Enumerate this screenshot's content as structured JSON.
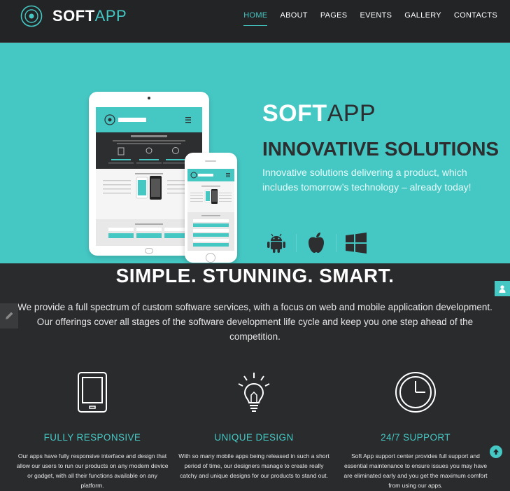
{
  "brand": {
    "bold": "SOFT",
    "light": "APP"
  },
  "nav": {
    "items": [
      {
        "label": "HOME",
        "active": true
      },
      {
        "label": "ABOUT"
      },
      {
        "label": "PAGES"
      },
      {
        "label": "EVENTS"
      },
      {
        "label": "GALLERY"
      },
      {
        "label": "CONTACTS"
      }
    ]
  },
  "hero": {
    "title_bold": "SOFT",
    "title_light": "APP",
    "subtitle": "INNOVATIVE SOLUTIONS",
    "text": "Innovative solutions delivering a product, which includes tomorrow’s technology – already today!",
    "platform_icons": [
      "android-icon",
      "apple-icon",
      "windows-icon"
    ]
  },
  "intro": {
    "title": "SIMPLE. STUNNING. SMART.",
    "text": "We provide a full spectrum of custom software services, with a focus on web and mobile application development. Our offerings cover all stages of the software development life cycle and keep you one step ahead of the competition."
  },
  "features": [
    {
      "icon": "tablet-icon",
      "title": "FULLY RESPONSIVE",
      "text": "Our apps have fully responsive interface and design that allow our users to run our products on any modern device or gadget, with all their functions available on any platform."
    },
    {
      "icon": "lightbulb-icon",
      "title": "UNIQUE DESIGN",
      "text": "With so many mobile apps being released in such a short period of time, our designers manage to create really catchy and unique designs for our products to stand out."
    },
    {
      "icon": "clock-icon",
      "title": "24/7 SUPPORT",
      "text": "Soft App support center provides full support and essential maintenance to ensure issues you may have are eliminated early and you get the maximum comfort from using our apps."
    }
  ],
  "colors": {
    "accent": "#45c8c4",
    "dark": "#2a2b2d",
    "nav": "#232426"
  }
}
